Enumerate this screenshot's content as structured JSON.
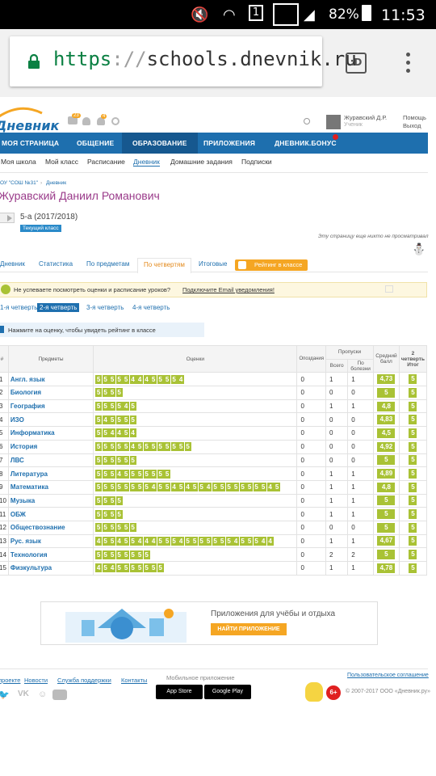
{
  "status_bar": {
    "battery": "82%",
    "time": "11:53",
    "sim": "1"
  },
  "browser": {
    "scheme": "https",
    "sep": "://",
    "host": "schools.dnevnik.ru",
    "tabs_label": ":D"
  },
  "site": {
    "logo": "Дневник",
    "badges": {
      "messages": "23",
      "notifications": "4"
    },
    "user": {
      "name": "Журавский Д.Р.",
      "role": "Ученик"
    },
    "help": "Помощь",
    "logout": "Выход",
    "nav": [
      "МОЯ СТРАНИЦА",
      "ОБЩЕНИЕ",
      "ОБРАЗОВАНИЕ",
      "ПРИЛОЖЕНИЯ",
      "ДНЕВНИК.БОНУС"
    ],
    "subnav": [
      "Моя школа",
      "Мой класс",
      "Расписание",
      "Дневник",
      "Домашние задания",
      "Подписки"
    ],
    "breadcrumb": [
      "ОУ \"СОШ №31\"",
      "Дневник"
    ],
    "student_name": "Журавский Даниил Романович",
    "class_label": "5-а (2017/2018)",
    "class_badge": "Текущий класс",
    "not_viewed": "Эту страницу еще никто не просматривал",
    "period_tabs": [
      "Дневник",
      "Статистика",
      "По предметам",
      "По четвертям",
      "Итоговые"
    ],
    "rating_button": "Рейтинг в классе",
    "email_notice": "Не успеваете посмотреть оценки и расписание уроков?",
    "email_link": "Подключите Email уведомления!",
    "quarters": [
      "1-я четверть",
      "2-я четверть",
      "3-я четверть",
      "4-я четверть"
    ],
    "hint": "Нажмите на оценку, чтобы увидеть рейтинг в классе",
    "table_headers": {
      "num": "#",
      "subjects": "Предметы",
      "grades": "Оценки",
      "late": "Опоздания",
      "missed": "Пропуски",
      "total": "Всего",
      "ill": "По болезни",
      "avg": "Средний балл",
      "final": "2 четверть Итог"
    },
    "rows": [
      {
        "n": "1",
        "subject": "Англ. язык",
        "grades": "5555544455554",
        "late": "0",
        "total": "1",
        "ill": "1",
        "avg": "4,73",
        "final": "5"
      },
      {
        "n": "2",
        "subject": "Биология",
        "grades": "5555",
        "late": "0",
        "total": "0",
        "ill": "0",
        "avg": "5",
        "final": "5"
      },
      {
        "n": "3",
        "subject": "География",
        "grades": "555545",
        "late": "0",
        "total": "1",
        "ill": "1",
        "avg": "4,8",
        "final": "5"
      },
      {
        "n": "4",
        "subject": "ИЗО",
        "grades": "545555",
        "late": "0",
        "total": "0",
        "ill": "0",
        "avg": "4,83",
        "final": "5"
      },
      {
        "n": "5",
        "subject": "Информатика",
        "grades": "554454",
        "late": "0",
        "total": "0",
        "ill": "0",
        "avg": "4,5",
        "final": "5"
      },
      {
        "n": "6",
        "subject": "История",
        "grades": "55555455555555",
        "late": "0",
        "total": "0",
        "ill": "0",
        "avg": "4,92",
        "final": "5"
      },
      {
        "n": "7",
        "subject": "ЛВС",
        "grades": "555555",
        "late": "0",
        "total": "0",
        "ill": "0",
        "avg": "5",
        "final": "5"
      },
      {
        "n": "8",
        "subject": "Литература",
        "grades": "55545555555",
        "late": "0",
        "total": "1",
        "ill": "1",
        "avg": "4,89",
        "final": "5"
      },
      {
        "n": "9",
        "subject": "Математика",
        "grades": "555555554554545545555555545",
        "late": "0",
        "total": "1",
        "ill": "1",
        "avg": "4,8",
        "final": "5"
      },
      {
        "n": "10",
        "subject": "Музыка",
        "grades": "5555",
        "late": "0",
        "total": "1",
        "ill": "1",
        "avg": "5",
        "final": "5"
      },
      {
        "n": "11",
        "subject": "ОБЖ",
        "grades": "5555",
        "late": "0",
        "total": "1",
        "ill": "1",
        "avg": "5",
        "final": "5"
      },
      {
        "n": "12",
        "subject": "Обществознание",
        "grades": "555555",
        "late": "0",
        "total": "0",
        "ill": "0",
        "avg": "5",
        "final": "5"
      },
      {
        "n": "13",
        "subject": "Рус. язык",
        "grades": "45545544455545555555455544",
        "late": "0",
        "total": "1",
        "ill": "1",
        "avg": "4,67",
        "final": "5"
      },
      {
        "n": "14",
        "subject": "Технология",
        "grades": "55555555",
        "late": "0",
        "total": "2",
        "ill": "2",
        "avg": "5",
        "final": "5"
      },
      {
        "n": "15",
        "subject": "Физкультура",
        "grades": "4545555555",
        "late": "0",
        "total": "1",
        "ill": "1",
        "avg": "4,78",
        "final": "5"
      }
    ],
    "banner_title": "Приложения для учёбы и отдыха",
    "banner_button": "НАЙТИ ПРИЛОЖЕНИЕ",
    "footer_links": [
      "проекте",
      "Новости",
      "Служба поддержки",
      "Контакты"
    ],
    "mobile_app": "Мобильное приложение",
    "app_store": "App Store",
    "google_play": "Google Play",
    "agreement": "Пользовательское соглашение",
    "age": "6+",
    "copyright": "© 2007-2017 ООО «Дневник.ру»"
  }
}
